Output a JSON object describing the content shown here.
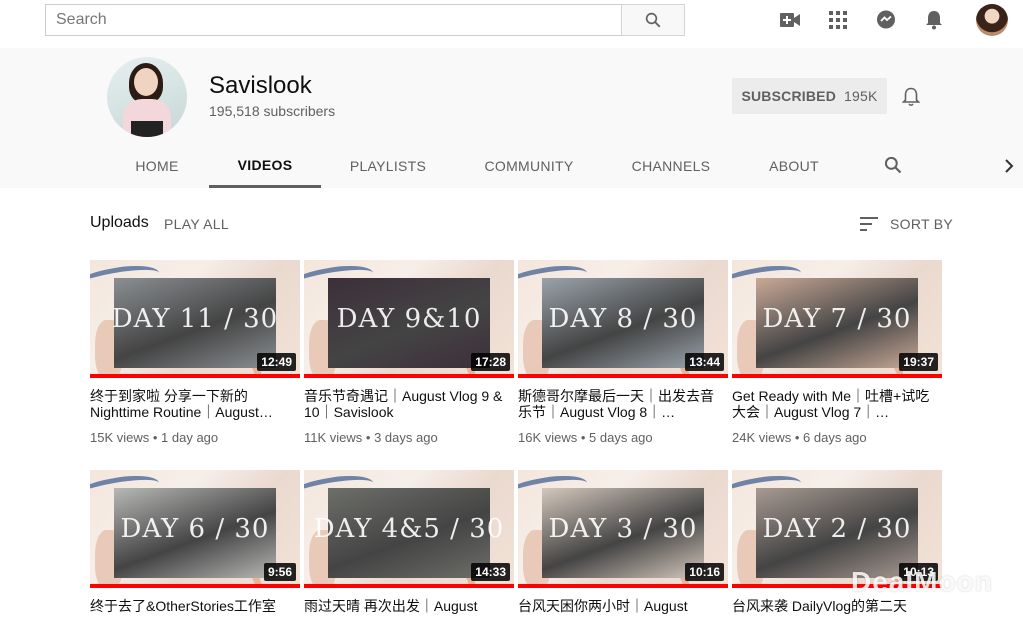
{
  "topbar": {
    "search_placeholder": "Search",
    "icons": [
      "search-icon",
      "create-video-icon",
      "apps-grid-icon",
      "messages-icon",
      "notifications-icon"
    ]
  },
  "channel": {
    "name": "Savislook",
    "subscribers": "195,518 subscribers",
    "subscribe_label": "SUBSCRIBED",
    "subscribe_count": "195K"
  },
  "tabs": [
    {
      "label": "HOME",
      "active": false
    },
    {
      "label": "VIDEOS",
      "active": true
    },
    {
      "label": "PLAYLISTS",
      "active": false
    },
    {
      "label": "COMMUNITY",
      "active": false
    },
    {
      "label": "CHANNELS",
      "active": false
    },
    {
      "label": "ABOUT",
      "active": false
    }
  ],
  "uploads": {
    "title": "Uploads",
    "play_all": "PLAY ALL",
    "sort_by": "SORT BY"
  },
  "videos": [
    {
      "overlay": "DAY 11 / 30",
      "duration": "12:49",
      "title": "终于到家啦 分享一下新的Nighttime Routine｜August…",
      "views": "15K views",
      "age": "1 day ago",
      "progress": 1.0,
      "photo": "#8b8f93"
    },
    {
      "overlay": "DAY 9&10",
      "duration": "17:28",
      "title": "音乐节奇遇记｜August Vlog 9 & 10｜Savislook",
      "views": "11K views",
      "age": "3 days ago",
      "progress": 1.0,
      "photo": "#3c2f3a"
    },
    {
      "overlay": "DAY 8 / 30",
      "duration": "13:44",
      "title": "斯德哥尔摩最后一天｜出发去音乐节｜August Vlog 8｜…",
      "views": "16K views",
      "age": "5 days ago",
      "progress": 1.0,
      "photo": "#9aa3ab"
    },
    {
      "overlay": "DAY 7 / 30",
      "duration": "19:37",
      "title": "Get Ready with Me｜吐槽+试吃大会｜August Vlog 7｜…",
      "views": "24K views",
      "age": "6 days ago",
      "progress": 1.0,
      "photo": "#c9a997"
    },
    {
      "overlay": "DAY 6 / 30",
      "duration": "9:56",
      "title": "终于去了&OtherStories工作室",
      "views": "",
      "age": "",
      "progress": 1.0,
      "photo": "#b7b9b6"
    },
    {
      "overlay": "DAY 4&5 / 30",
      "duration": "14:33",
      "title": "雨过天晴 再次出发｜August",
      "views": "",
      "age": "",
      "progress": 1.0,
      "photo": "#6d6f6a"
    },
    {
      "overlay": "DAY 3 / 30",
      "duration": "10:16",
      "title": "台风天困你两小时｜August",
      "views": "",
      "age": "",
      "progress": 1.0,
      "photo": "#d4c8bd"
    },
    {
      "overlay": "DAY 2 / 30",
      "duration": "10:13",
      "title": "台风来袭 DailyVlog的第二天",
      "views": "",
      "age": "",
      "progress": 1.0,
      "photo": "#a89a92"
    }
  ],
  "watermark": "DealMoon"
}
